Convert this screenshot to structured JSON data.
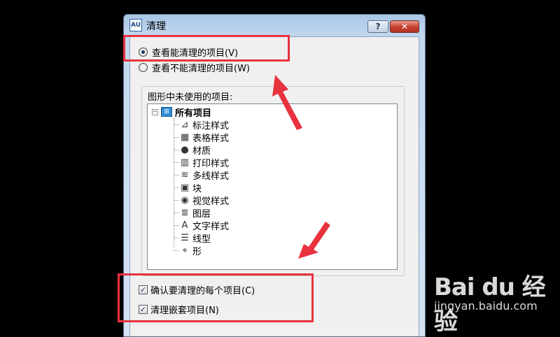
{
  "window": {
    "title": "清理",
    "app_icon_text": "AU",
    "help_glyph": "?",
    "close_glyph": "✕"
  },
  "options": {
    "view_purgeable": "查看能清理的项目(V)",
    "view_non_purgeable": "查看不能清理的项目(W)",
    "selected": "view_purgeable"
  },
  "tree": {
    "group_label": "图形中未使用的项目:",
    "root_label": "所有项目",
    "items": [
      {
        "label": "标注样式",
        "icon": "dimension-style-icon",
        "glyph": "⊿"
      },
      {
        "label": "表格样式",
        "icon": "table-style-icon",
        "glyph": "▦"
      },
      {
        "label": "材质",
        "icon": "material-icon",
        "glyph": "●"
      },
      {
        "label": "打印样式",
        "icon": "plot-style-icon",
        "glyph": "▥"
      },
      {
        "label": "多线样式",
        "icon": "multiline-style-icon",
        "glyph": "≋"
      },
      {
        "label": "块",
        "icon": "block-icon",
        "glyph": "▣"
      },
      {
        "label": "视觉样式",
        "icon": "visual-style-icon",
        "glyph": "◉"
      },
      {
        "label": "图层",
        "icon": "layer-icon",
        "glyph": "≣"
      },
      {
        "label": "文字样式",
        "icon": "text-style-icon",
        "glyph": "A"
      },
      {
        "label": "线型",
        "icon": "linetype-icon",
        "glyph": "☰"
      },
      {
        "label": "形",
        "icon": "shape-icon",
        "glyph": "⌖"
      }
    ]
  },
  "checks": {
    "confirm_each": "确认要清理的每个项目(C)",
    "purge_nested": "清理嵌套项目(N)",
    "confirm_checked": true,
    "nested_checked": true,
    "check_glyph": "✓"
  },
  "watermark": {
    "logo": "Bai du 经验",
    "url": "jingyan.baidu.com"
  },
  "colors": {
    "annotation_red": "#e8333f"
  }
}
